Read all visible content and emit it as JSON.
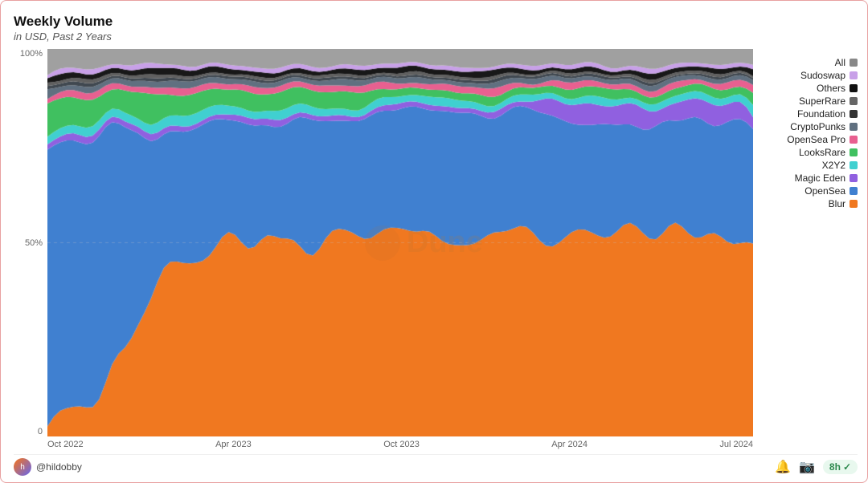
{
  "title": "Weekly Volume",
  "subtitle": "in USD, Past 2 Years",
  "y_axis_labels": [
    "100%",
    "50%",
    "0"
  ],
  "x_axis_labels": [
    "Oct 2022",
    "Apr 2023",
    "Oct 2023",
    "Apr 2024",
    "Jul 2024"
  ],
  "legend": [
    {
      "label": "All",
      "color": "#888888"
    },
    {
      "label": "Sudoswap",
      "color": "#c8a0e8"
    },
    {
      "label": "Others",
      "color": "#111111"
    },
    {
      "label": "SuperRare",
      "color": "#666666"
    },
    {
      "label": "Foundation",
      "color": "#333333"
    },
    {
      "label": "CryptoPunks",
      "color": "#607080"
    },
    {
      "label": "OpenSea Pro",
      "color": "#e86090"
    },
    {
      "label": "LooksRare",
      "color": "#40c060"
    },
    {
      "label": "X2Y2",
      "color": "#40d0d0"
    },
    {
      "label": "Magic Eden",
      "color": "#9060e0"
    },
    {
      "label": "OpenSea",
      "color": "#4080d0"
    },
    {
      "label": "Blur",
      "color": "#f07820"
    }
  ],
  "footer": {
    "username": "@hildobby",
    "time_badge": "8h",
    "camera_icon": "📷",
    "bell_icon": "🔔"
  },
  "colors": {
    "blur": "#f07820",
    "opensea": "#4080d0",
    "magic_eden": "#9060e0",
    "x2y2": "#40d0d0",
    "looksrare": "#40c060",
    "opensea_pro": "#e86090",
    "cryptopunks": "#607080",
    "foundation": "#333333",
    "superrare": "#666666",
    "others": "#111111",
    "sudoswap": "#c8a0e8",
    "all": "#888888"
  }
}
